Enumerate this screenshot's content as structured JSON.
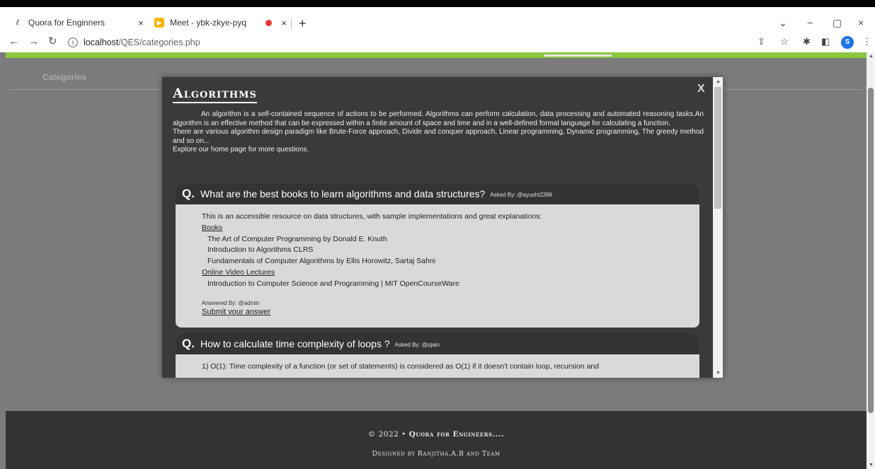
{
  "browser": {
    "tabs": [
      {
        "title": "Quora for Enginners",
        "close": "×"
      },
      {
        "title": "Meet - ybk-zkye-pyq",
        "close": "×"
      }
    ],
    "new_tab": "+",
    "url_host": "localhost",
    "url_path": "/QES/categories.php",
    "profile_initial": "S",
    "window_controls": {
      "dropdown": "⌄",
      "minimize": "−",
      "restore": "▢",
      "close": "×"
    }
  },
  "page": {
    "categories_label": "Categories"
  },
  "modal": {
    "close_label": "X",
    "title": "Algorithms",
    "desc_p1": "An algorithm is a self-contained sequence of actions to be performed. Algorithms can perform calculation, data processing and automated reasoning tasks.An algorithm is an effective method that can be expressed within a finite amount of space and time and in a well-defined formal language for calculating a function.",
    "desc_p2": "There are various algorithm design paradigm like Brute-Force approach, Divide and conquer approach, Linear programming, Dynamic programming, The greedy method and so on...",
    "desc_p3": "Explore our home page for more questions.",
    "questions": [
      {
        "mark": "Q.",
        "title": "What are the best books to learn algorithms and data structures?",
        "asked_by": "Asked By: @ayusht2396",
        "intro": "This is an accessible resource on data structures, with sample implementations and great explanations:",
        "section1": "Books",
        "books": [
          "The Art of Computer Programming by Donald E. Knuth",
          "Introduction to Algorithms CLRS",
          "Fundamentals of Computer Algorithms by Ellis Horowitz, Sartaj Sahni"
        ],
        "section2": "Online Video Lectures",
        "lectures": [
          "Introduction to Computer Science and Programming | MIT OpenCourseWare"
        ],
        "answered_by": "Answered By: @admin",
        "submit_label": "Submit your answer"
      },
      {
        "mark": "Q.",
        "title": "How to calculate time complexity of loops ?",
        "asked_by": "Asked By: @pjain",
        "intro": "1) O(1): Time complexity of a function (or set of statements) is considered as O(1) if it doesn't contain loop, recursion and"
      }
    ]
  },
  "footer": {
    "copyright": "© 2022 •",
    "brand": "Quora for Engineers....",
    "designed_by": "Designed by Ranjitha.A.B and Team"
  },
  "colors": {
    "accent_green": "#8dc63f",
    "modal_bg": "#3a3a3a",
    "card_bg": "#d9d9d9",
    "footer_bg": "#333333"
  }
}
